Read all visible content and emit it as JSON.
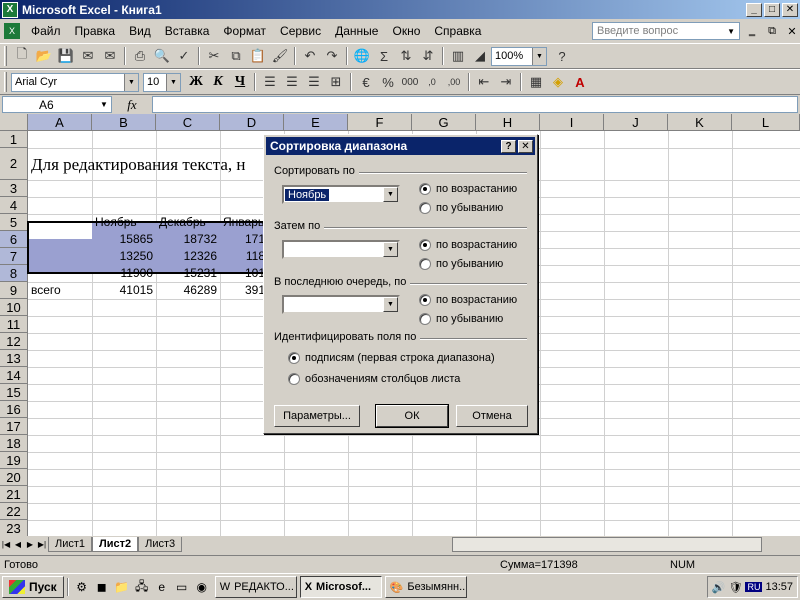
{
  "window": {
    "title": "Microsoft Excel - Книга1",
    "app_icon": "X",
    "minimize": "_",
    "maximize": "□",
    "close": "✕"
  },
  "menu": {
    "items": [
      "Файл",
      "Правка",
      "Вид",
      "Вставка",
      "Формат",
      "Сервис",
      "Данные",
      "Окно",
      "Справка"
    ],
    "help_placeholder": "Введите вопрос",
    "doc_min": "‗",
    "doc_restore": "⧉",
    "doc_close": "✕"
  },
  "toolbar_standard": {
    "zoom": "100%"
  },
  "toolbar_format": {
    "font": "Arial Cyr",
    "size": "10",
    "bold": "Ж",
    "italic": "К",
    "underline": "Ч"
  },
  "formula_bar": {
    "name_box": "A6",
    "fx": "fx"
  },
  "grid": {
    "columns": [
      "A",
      "B",
      "C",
      "D",
      "E",
      "F",
      "G",
      "H",
      "I",
      "J",
      "K",
      "L"
    ],
    "rows": [
      "1",
      "2",
      "3",
      "4",
      "5",
      "6",
      "7",
      "8",
      "9",
      "10",
      "11",
      "12",
      "13",
      "14",
      "15",
      "16",
      "17",
      "18",
      "19",
      "20",
      "21",
      "22",
      "23"
    ],
    "cells": {
      "A2": "Для редактирования текста, н",
      "B5": "Ноябрь",
      "C5": "Декабрь",
      "D5": "Январь",
      "B6": "15865",
      "C6": "18732",
      "D6": "171",
      "B7": "13250",
      "C7": "12326",
      "D7": "118",
      "B8": "11900",
      "C8": "15231",
      "D8": "101",
      "A9": "всего",
      "B9": "41015",
      "C9": "46289",
      "D9": "391"
    }
  },
  "sheets": {
    "tabs": [
      "Лист1",
      "Лист2",
      "Лист3"
    ],
    "active": "Лист2"
  },
  "status": {
    "ready": "Готово",
    "sum": "Сумма=171398",
    "num": "NUM"
  },
  "taskbar": {
    "start": "Пуск",
    "tasks": [
      "РЕДАКТО...",
      "Microsof...",
      "Безымянн..."
    ],
    "active_task": "Microsof...",
    "lang": "RU",
    "clock": "13:57"
  },
  "dialog": {
    "title": "Сортировка диапазона",
    "help_btn": "?",
    "close_btn": "✕",
    "sort_by_label": "Сортировать по",
    "sort_by_value": "Ноябрь",
    "then_by_label": "Затем по",
    "last_by_label": "В последнюю очередь, по",
    "asc": "по возрастанию",
    "desc": "по убыванию",
    "identify_label": "Идентифицировать поля по",
    "opt_labels": "подписям (первая строка диапазона)",
    "opt_columns": "обозначениям столбцов листа",
    "btn_params": "Параметры...",
    "btn_ok": "ОК",
    "btn_cancel": "Отмена"
  }
}
